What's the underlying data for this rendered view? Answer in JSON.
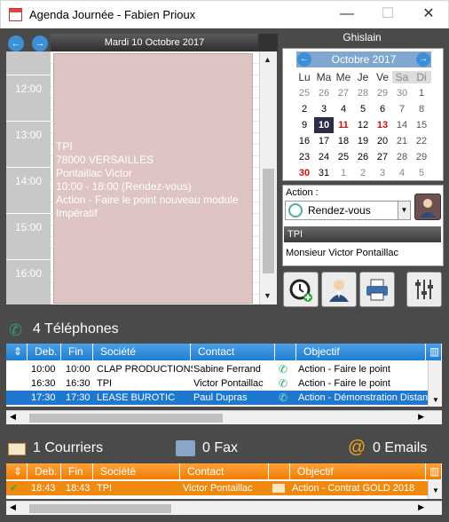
{
  "window": {
    "title": "Agenda Journée - Fabien Prioux",
    "minimize": "—",
    "maximize": "☐",
    "close": "✕"
  },
  "agenda": {
    "prev": "←",
    "next": "→",
    "day_title": "Mardi 10 Octobre 2017",
    "hours": [
      "12:00",
      "13:00",
      "14:00",
      "15:00",
      "16:00"
    ],
    "appointment": {
      "lines": [
        "TPI",
        "78000 VERSAILLES",
        "Pontaillac Victor",
        "10:00 - 18:00 (Rendez-vous)",
        "Action - Faire le point nouveau module",
        "Impératif"
      ],
      "color": "#dfc4c4"
    }
  },
  "calendar": {
    "person": "Ghislain",
    "month": "Octobre 2017",
    "weekdays": [
      "Lu",
      "Ma",
      "Me",
      "Je",
      "Ve",
      "Sa",
      "Di"
    ],
    "weeks": [
      [
        "25",
        "26",
        "27",
        "28",
        "29",
        "30",
        "1"
      ],
      [
        "2",
        "3",
        "4",
        "5",
        "6",
        "7",
        "8"
      ],
      [
        "9",
        "10",
        "11",
        "12",
        "13",
        "14",
        "15"
      ],
      [
        "16",
        "17",
        "18",
        "19",
        "20",
        "21",
        "22"
      ],
      [
        "23",
        "24",
        "25",
        "26",
        "27",
        "28",
        "29"
      ],
      [
        "30",
        "31",
        "1",
        "2",
        "3",
        "4",
        "5"
      ]
    ],
    "selected": "10"
  },
  "action": {
    "label": "Action :",
    "value": "Rendez-vous",
    "company": "TPI",
    "contact": "Monsieur Victor Pontaillac"
  },
  "telephones": {
    "heading": "4 Téléphones",
    "columns": [
      "Deb.",
      "Fin",
      "Société",
      "Contact",
      "Objectif"
    ],
    "rows": [
      {
        "deb": "10:00",
        "fin": "10:00",
        "societe": "CLAP PRODUCTIONS",
        "contact": "Sabine Ferrand",
        "objectif": "Action - Faire le point"
      },
      {
        "deb": "16:30",
        "fin": "16:30",
        "societe": "TPI",
        "contact": "Victor Pontaillac",
        "objectif": "Action - Faire le point"
      },
      {
        "deb": "17:30",
        "fin": "17:30",
        "societe": "LEASE BUROTIC",
        "contact": "Paul Dupras",
        "objectif": "Action - Démonstration Distan"
      }
    ]
  },
  "courriers": {
    "heading": "1 Courriers",
    "fax": "0 Fax",
    "emails": "0 Emails",
    "columns": [
      "Deb.",
      "Fin",
      "Société",
      "Contact",
      "Objectif"
    ],
    "rows": [
      {
        "deb": "18:43",
        "fin": "18:43",
        "societe": "TPI",
        "contact": "Victor Pontaillac",
        "objectif": "Action - Contrat GOLD 2018"
      }
    ]
  },
  "colors": {
    "accent": "#1f7fd0",
    "orange": "#ee7a00",
    "dark": "#4a4a4a",
    "phone": "#2aa36f"
  }
}
